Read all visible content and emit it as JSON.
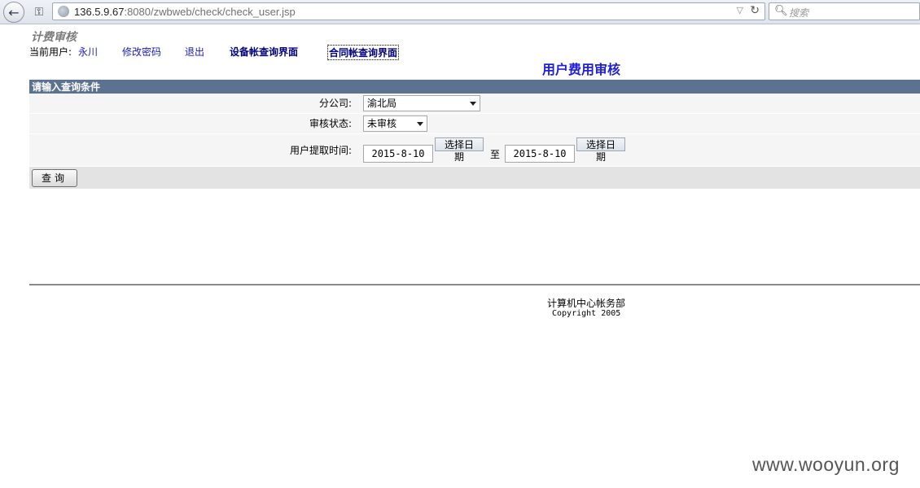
{
  "browser": {
    "url_host": "136.5.9.67",
    "url_rest": ":8080/zwbweb/check/check_user.jsp",
    "search_placeholder": "搜索"
  },
  "site": {
    "title": "计费审核"
  },
  "nav": {
    "user_prefix": "当前用户:",
    "user_name": "永川",
    "change_password": "修改密码",
    "logout": "退出",
    "device_query": "设备帐查询界面",
    "contract_query": "合同帐查询界面"
  },
  "main": {
    "title": "用户费用审核",
    "section_header": "请输入查询条件",
    "branch_label": "分公司:",
    "branch_value": "渝北局",
    "status_label": "审核状态:",
    "status_value": "未审核",
    "time_label": "用户提取时间:",
    "date_from": "2015-8-10",
    "date_to": "2015-8-10",
    "pick_date_top": "选择日",
    "pick_date_bottom": "期",
    "to_label": "至",
    "query_button": "查询"
  },
  "footer": {
    "department": "计算机中心帐务部",
    "copyright": "Copyright 2005"
  },
  "watermark": "www.wooyun.org",
  "colors": {
    "header_bg": "#5b7390",
    "link": "#1b1bb8",
    "main_title": "#1e1edc"
  }
}
